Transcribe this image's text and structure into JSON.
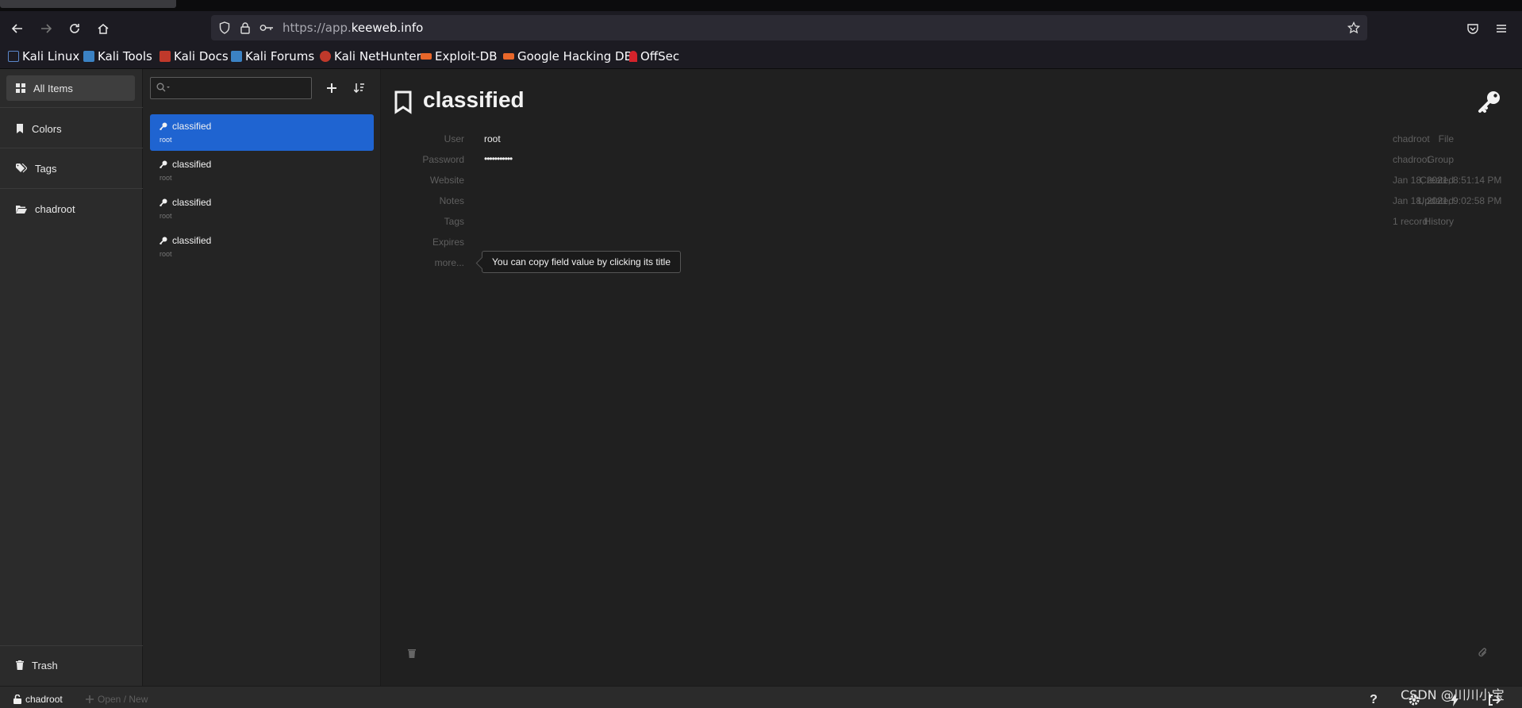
{
  "browser": {
    "url_prefix": "https://app.",
    "url_domain": "keeweb.info",
    "bookmarks": [
      {
        "label": "Kali Linux",
        "color": "#2c6ed5"
      },
      {
        "label": "Kali Tools",
        "color": "#3b82c4"
      },
      {
        "label": "Kali Docs",
        "color": "#c0392b"
      },
      {
        "label": "Kali Forums",
        "color": "#3b82c4"
      },
      {
        "label": "Kali NetHunter",
        "color": "#c0392b"
      },
      {
        "label": "Exploit-DB",
        "color": "#e8672a"
      },
      {
        "label": "Google Hacking DB",
        "color": "#e8672a"
      },
      {
        "label": "OffSec",
        "color": "#d4232b"
      }
    ]
  },
  "menu": {
    "items": [
      {
        "label": "All Items",
        "icon": "grid-icon"
      },
      {
        "label": "Colors",
        "icon": "bookmark-icon"
      },
      {
        "label": "Tags",
        "icon": "tags-icon"
      },
      {
        "label": "chadroot",
        "icon": "folder-icon"
      }
    ],
    "trash_label": "Trash"
  },
  "list": {
    "entries": [
      {
        "title": "classified",
        "user": "root"
      },
      {
        "title": "classified",
        "user": "root"
      },
      {
        "title": "classified",
        "user": "root"
      },
      {
        "title": "classified",
        "user": "root"
      }
    ]
  },
  "details": {
    "title": "classified",
    "fields": [
      {
        "label": "User",
        "value": "root"
      },
      {
        "label": "Password",
        "value": "•••••••••••"
      },
      {
        "label": "Website",
        "value": ""
      },
      {
        "label": "Notes",
        "value": ""
      },
      {
        "label": "Tags",
        "value": ""
      },
      {
        "label": "Expires",
        "value": ""
      },
      {
        "label": "more...",
        "value": ""
      }
    ],
    "aside": [
      {
        "label": "File",
        "value": "chadroot"
      },
      {
        "label": "Group",
        "value": "chadroot"
      },
      {
        "label": "Created",
        "value": "Jan 18, 2021, 8:51:14 PM"
      },
      {
        "label": "Updated",
        "value": "Jan 18, 2021, 9:02:58 PM"
      },
      {
        "label": "History",
        "value": "1 record"
      }
    ],
    "tooltip": "You can copy field value by clicking its title"
  },
  "footer": {
    "file_name": "chadroot",
    "open_new": "Open / New"
  },
  "watermark": "CSDN @川川小宝",
  "colors": {
    "accent": "#1f64d1",
    "background": "#202020"
  }
}
